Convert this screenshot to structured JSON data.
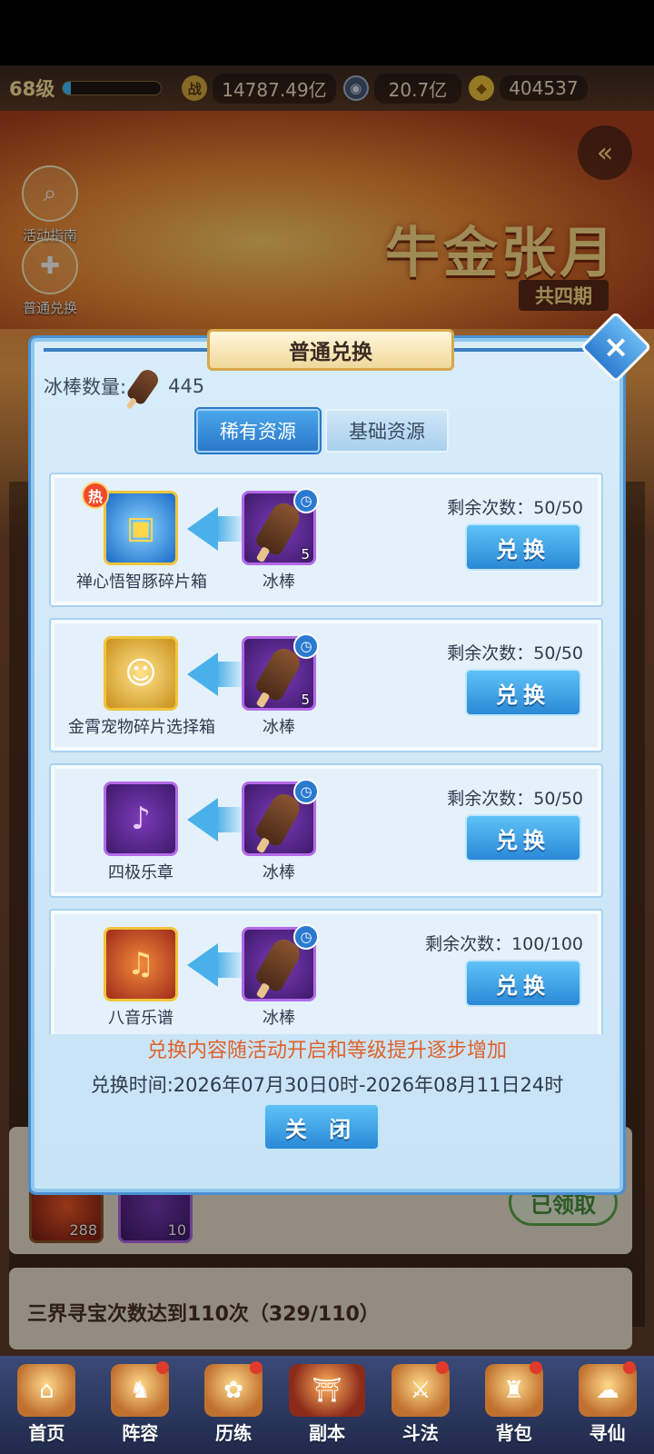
{
  "status": {
    "level": "68级",
    "exp_fraction": 0.08,
    "resources": [
      {
        "icon": "power-icon",
        "value": "14787.49亿",
        "color": "#d8a840"
      },
      {
        "icon": "coin-icon",
        "value": "20.7亿",
        "color": "#4a5a7a"
      },
      {
        "icon": "gold-ingot-icon",
        "value": "404537",
        "color": "#f0c43a"
      }
    ]
  },
  "banner": {
    "title": "牛金张月",
    "subtitle": "共四期"
  },
  "side": {
    "guide_label": "活动指南",
    "exchange_label": "普通兑换"
  },
  "background": {
    "claimed_label": "已领取",
    "item_qty_1": "288",
    "item_qty_2": "10",
    "task_text": "三界寻宝次数达到110次（329/110）"
  },
  "dialog": {
    "title": "普通兑换",
    "currency_label": "冰棒数量:",
    "currency_count": "445",
    "tabs": [
      "稀有资源",
      "基础资源"
    ],
    "active_tab": 0,
    "rows": [
      {
        "reward": "禅心悟智豚碎片箱",
        "reward_icon": "treasure-chest-icon",
        "hot": "热",
        "cost_item": "冰棒",
        "cost_qty": "5",
        "remaining": "剩余次数：50/50",
        "button": "兑换"
      },
      {
        "reward": "金霄宠物碎片选择箱",
        "reward_icon": "pet-chest-icon",
        "hot": "",
        "cost_item": "冰棒",
        "cost_qty": "5",
        "remaining": "剩余次数：50/50",
        "button": "兑换"
      },
      {
        "reward": "四极乐章",
        "reward_icon": "music-book-icon",
        "hot": "",
        "cost_item": "冰棒",
        "cost_qty": "",
        "remaining": "剩余次数：50/50",
        "button": "兑换"
      },
      {
        "reward": "八音乐谱",
        "reward_icon": "music-score-icon",
        "hot": "",
        "cost_item": "冰棒",
        "cost_qty": "",
        "remaining": "剩余次数：100/100",
        "button": "兑换"
      }
    ],
    "note": "兑换内容随活动开启和等级提升逐步增加",
    "time": "兑换时间:2026年07月30日0时-2026年08月11日24时",
    "close_label": "关 闭"
  },
  "nav": [
    {
      "label": "首页",
      "icon": "home-icon",
      "dot": false
    },
    {
      "label": "阵容",
      "icon": "lineup-icon",
      "dot": true
    },
    {
      "label": "历练",
      "icon": "training-icon",
      "dot": true
    },
    {
      "label": "副本",
      "icon": "dungeon-icon",
      "dot": false
    },
    {
      "label": "斗法",
      "icon": "battle-icon",
      "dot": true
    },
    {
      "label": "背包",
      "icon": "bag-icon",
      "dot": true
    },
    {
      "label": "寻仙",
      "icon": "seek-immortal-icon",
      "dot": true
    }
  ]
}
